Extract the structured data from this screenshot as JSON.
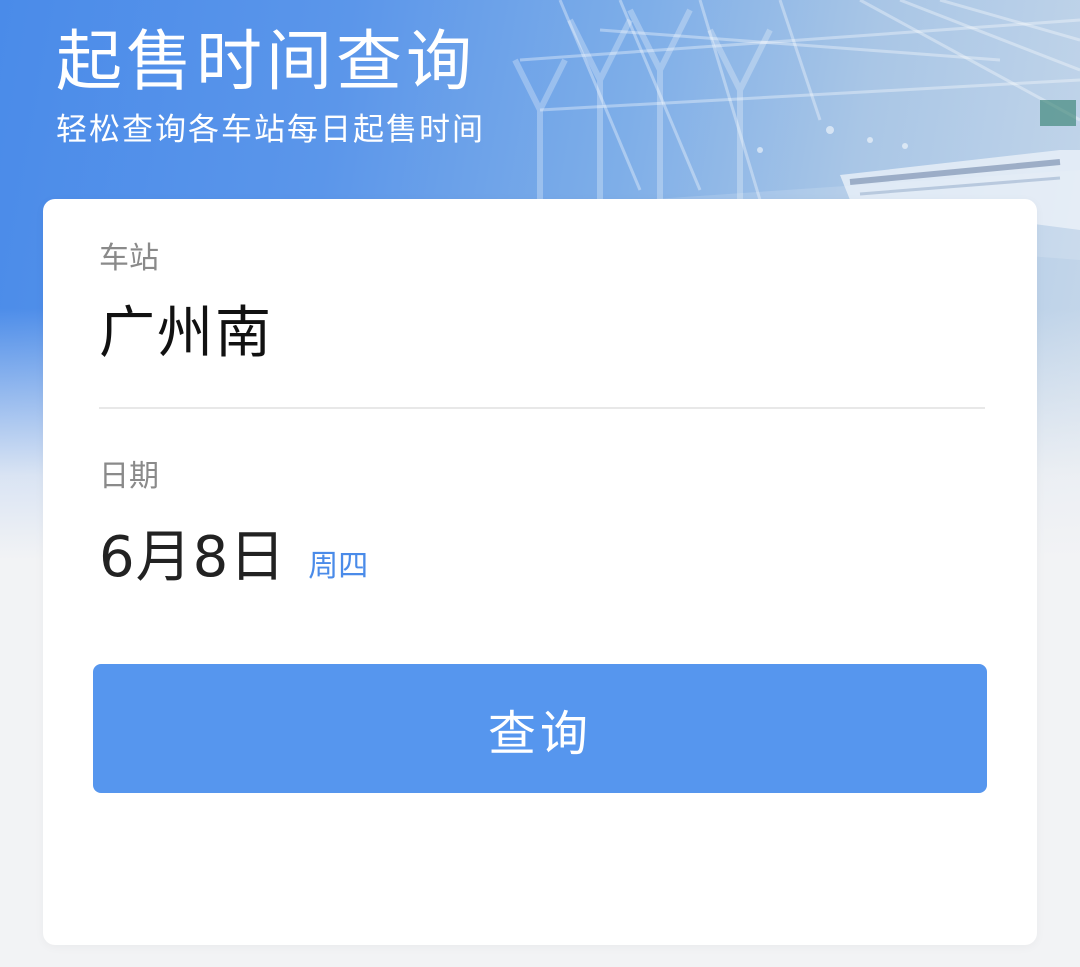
{
  "header": {
    "title": "起售时间查询",
    "subtitle": "轻松查询各车站每日起售时间"
  },
  "form": {
    "station": {
      "label": "车站",
      "value": "广州南"
    },
    "date": {
      "label": "日期",
      "value": "6月8日",
      "weekday": "周四"
    },
    "submit_label": "查询"
  },
  "colors": {
    "accent": "#5696ee",
    "weekday_text": "#4a8be9",
    "banner_start": "#4a8be9"
  }
}
